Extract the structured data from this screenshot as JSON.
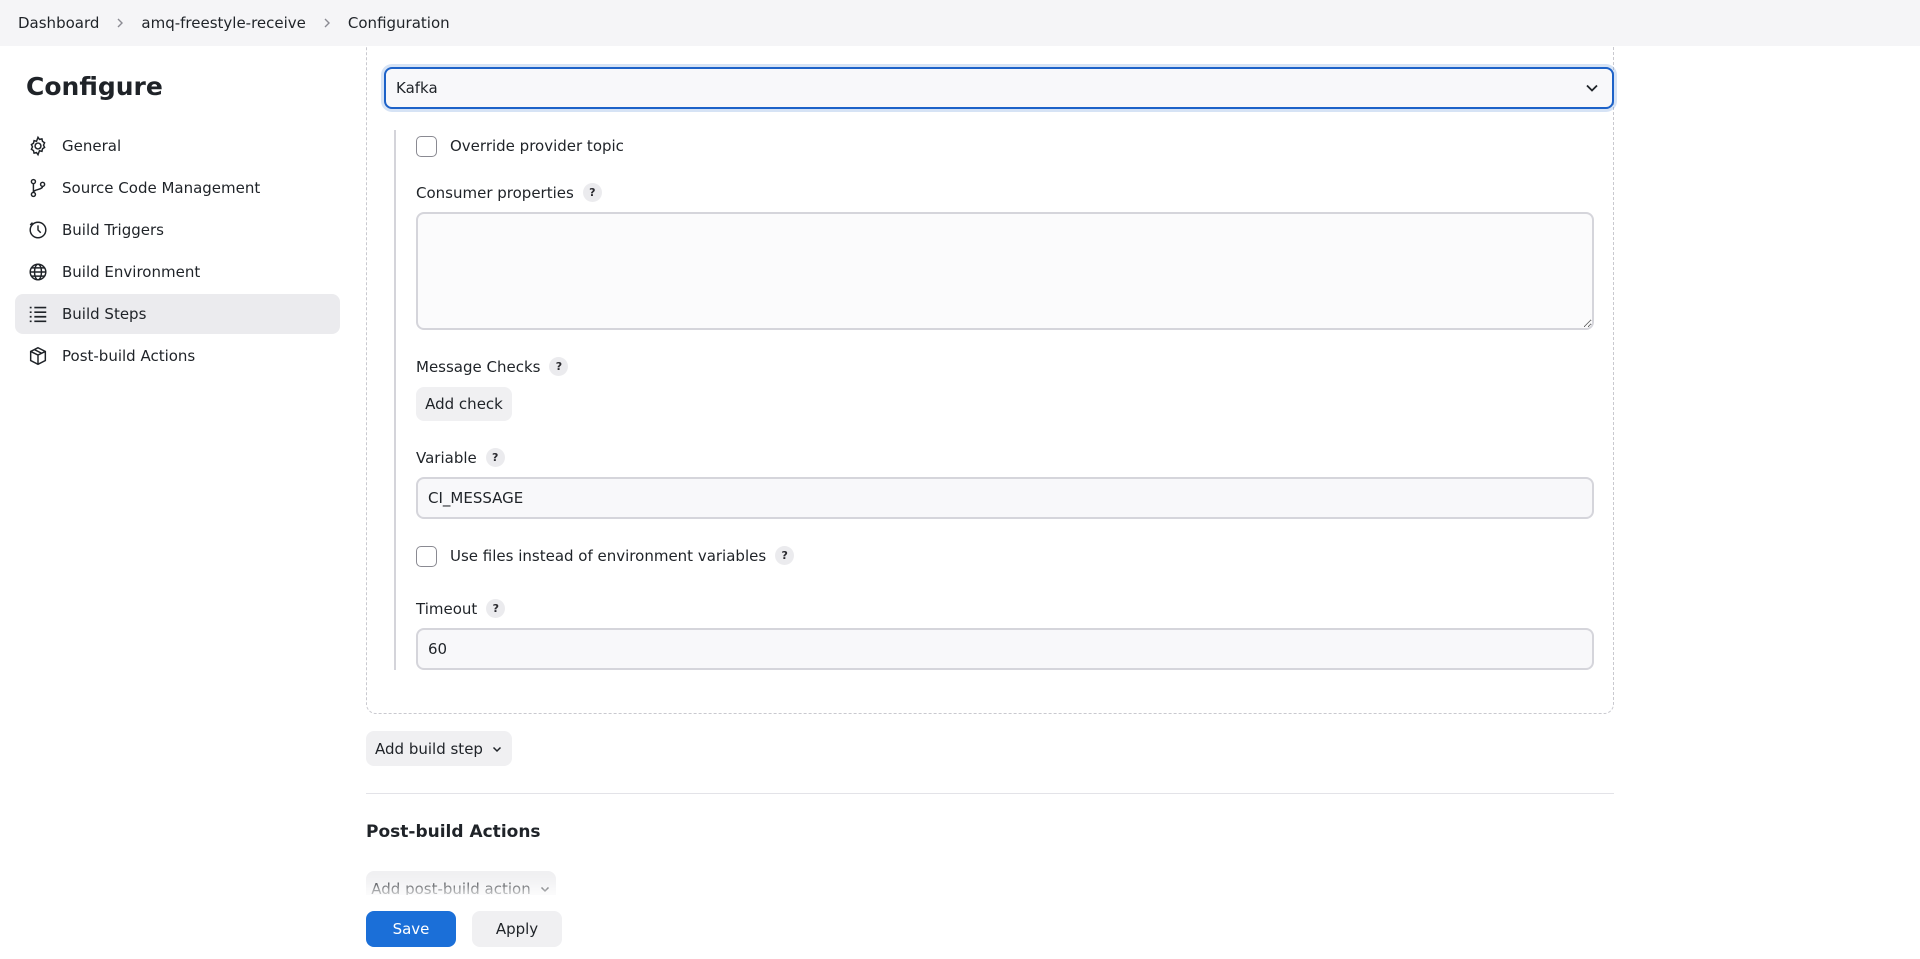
{
  "breadcrumb": {
    "items": [
      "Dashboard",
      "amq-freestyle-receive",
      "Configuration"
    ]
  },
  "sidebar": {
    "title": "Configure",
    "items": [
      {
        "label": "General",
        "icon": "gear-icon"
      },
      {
        "label": "Source Code Management",
        "icon": "git-branch-icon"
      },
      {
        "label": "Build Triggers",
        "icon": "clock-icon"
      },
      {
        "label": "Build Environment",
        "icon": "globe-icon"
      },
      {
        "label": "Build Steps",
        "icon": "list-icon",
        "active": true
      },
      {
        "label": "Post-build Actions",
        "icon": "package-icon"
      }
    ]
  },
  "build_step": {
    "provider_select": "Kafka",
    "override_topic_label": "Override provider topic",
    "consumer_properties_label": "Consumer properties",
    "consumer_properties_value": "",
    "message_checks_label": "Message Checks",
    "add_check_label": "Add check",
    "variable_label": "Variable",
    "variable_value": "CI_MESSAGE",
    "use_files_label": "Use files instead of environment variables",
    "timeout_label": "Timeout",
    "timeout_value": "60",
    "help_glyph": "?"
  },
  "add_build_step_label": "Add build step",
  "post_build": {
    "title": "Post-build Actions",
    "add_label": "Add post-build action"
  },
  "footer": {
    "save_label": "Save",
    "apply_label": "Apply"
  },
  "colors": {
    "accent": "#1b6fd8",
    "active_nav_bg": "#ebebee"
  }
}
